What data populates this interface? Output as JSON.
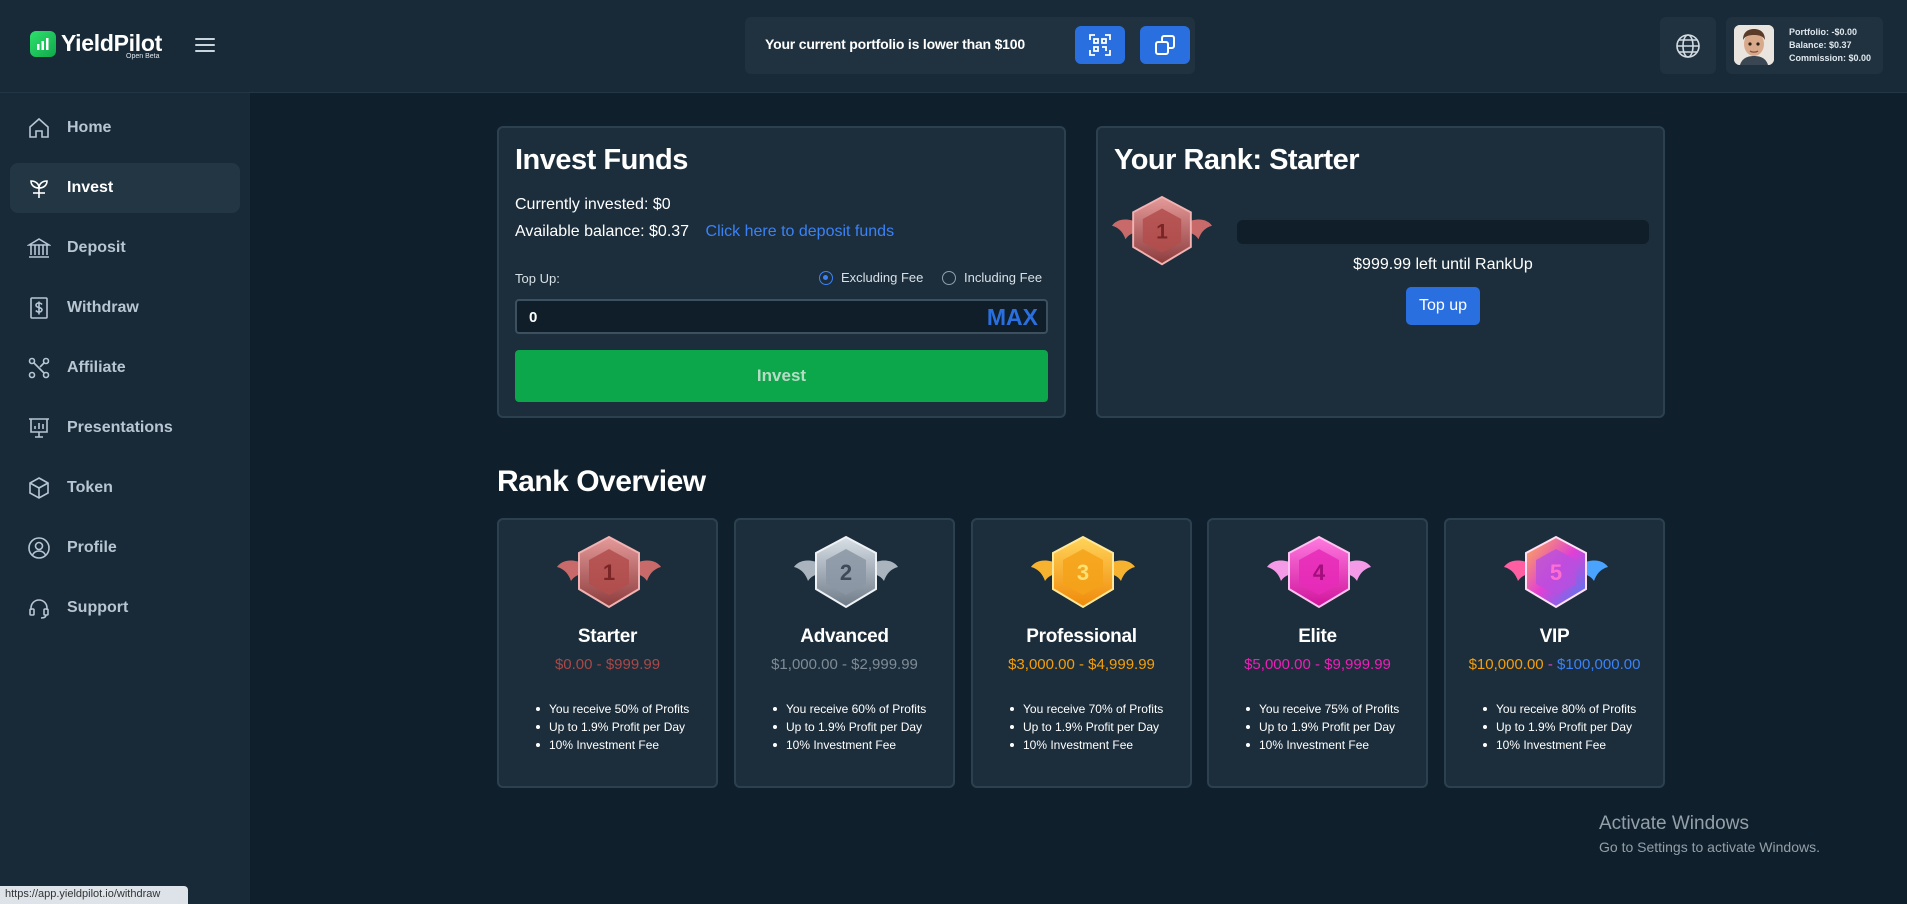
{
  "header": {
    "brand": "YieldPilot",
    "brand_sub": "Open Beta",
    "notice": "Your current portfolio is lower than $100",
    "user": {
      "portfolio": "Portfolio: -$0.00",
      "balance": "Balance: $0.37",
      "commission": "Commission: $0.00"
    }
  },
  "sidebar": {
    "items": [
      {
        "label": "Home",
        "icon": "home-icon"
      },
      {
        "label": "Invest",
        "icon": "sprout-icon"
      },
      {
        "label": "Deposit",
        "icon": "bank-icon"
      },
      {
        "label": "Withdraw",
        "icon": "withdraw-icon"
      },
      {
        "label": "Affiliate",
        "icon": "affiliate-icon"
      },
      {
        "label": "Presentations",
        "icon": "presentation-icon"
      },
      {
        "label": "Token",
        "icon": "token-icon"
      },
      {
        "label": "Profile",
        "icon": "user-icon"
      },
      {
        "label": "Support",
        "icon": "headset-icon"
      }
    ],
    "active": "Invest"
  },
  "invest": {
    "title": "Invest Funds",
    "currently_invested": "Currently invested: $0",
    "available_balance": "Available balance: $0.37",
    "deposit_link": "Click here to deposit funds",
    "topup_label": "Top Up:",
    "option_excluding": "Excluding Fee",
    "option_including": "Including Fee",
    "amount_value": "0",
    "max_label": "MAX",
    "invest_button": "Invest"
  },
  "rank": {
    "title": "Your Rank: Starter",
    "badge_number": "1",
    "progress_fraction": 0,
    "left_until": "$999.99 left until RankUp",
    "topup_button": "Top up"
  },
  "overview": {
    "title": "Rank Overview",
    "cards": [
      {
        "number": "1",
        "name": "Starter",
        "range": "$0.00 - $999.99",
        "perks": [
          "You receive 50% of Profits",
          "Up to 1.9% Profit per Day",
          "10% Investment Fee"
        ]
      },
      {
        "number": "2",
        "name": "Advanced",
        "range": "$1,000.00 - $2,999.99",
        "perks": [
          "You receive 60% of Profits",
          "Up to 1.9% Profit per Day",
          "10% Investment Fee"
        ]
      },
      {
        "number": "3",
        "name": "Professional",
        "range": "$3,000.00 - $4,999.99",
        "perks": [
          "You receive 70% of Profits",
          "Up to 1.9% Profit per Day",
          "10% Investment Fee"
        ]
      },
      {
        "number": "4",
        "name": "Elite",
        "range": "$5,000.00 - $9,999.99",
        "perks": [
          "You receive 75% of Profits",
          "Up to 1.9% Profit per Day",
          "10% Investment Fee"
        ]
      },
      {
        "number": "5",
        "name": "VIP",
        "range_low": "$10,000.00",
        "range_sep": " - ",
        "range_high": "$100,000.00",
        "perks": [
          "You receive 80% of Profits",
          "Up to 1.9% Profit per Day",
          "10% Investment Fee"
        ]
      }
    ]
  },
  "watermark": {
    "line1": "Activate Windows",
    "line2": "Go to Settings to activate Windows."
  },
  "status_url": "https://app.yieldpilot.io/withdraw",
  "colors": {
    "accent": "#2a6fe0",
    "invest_green": "#0ca74a",
    "starter": "#a94848",
    "advanced": "#7f8b96",
    "professional": "#f59e0b",
    "elite": "#ec1fb8",
    "vip_low": "#f59e0b",
    "vip_high": "#3b82f6"
  }
}
